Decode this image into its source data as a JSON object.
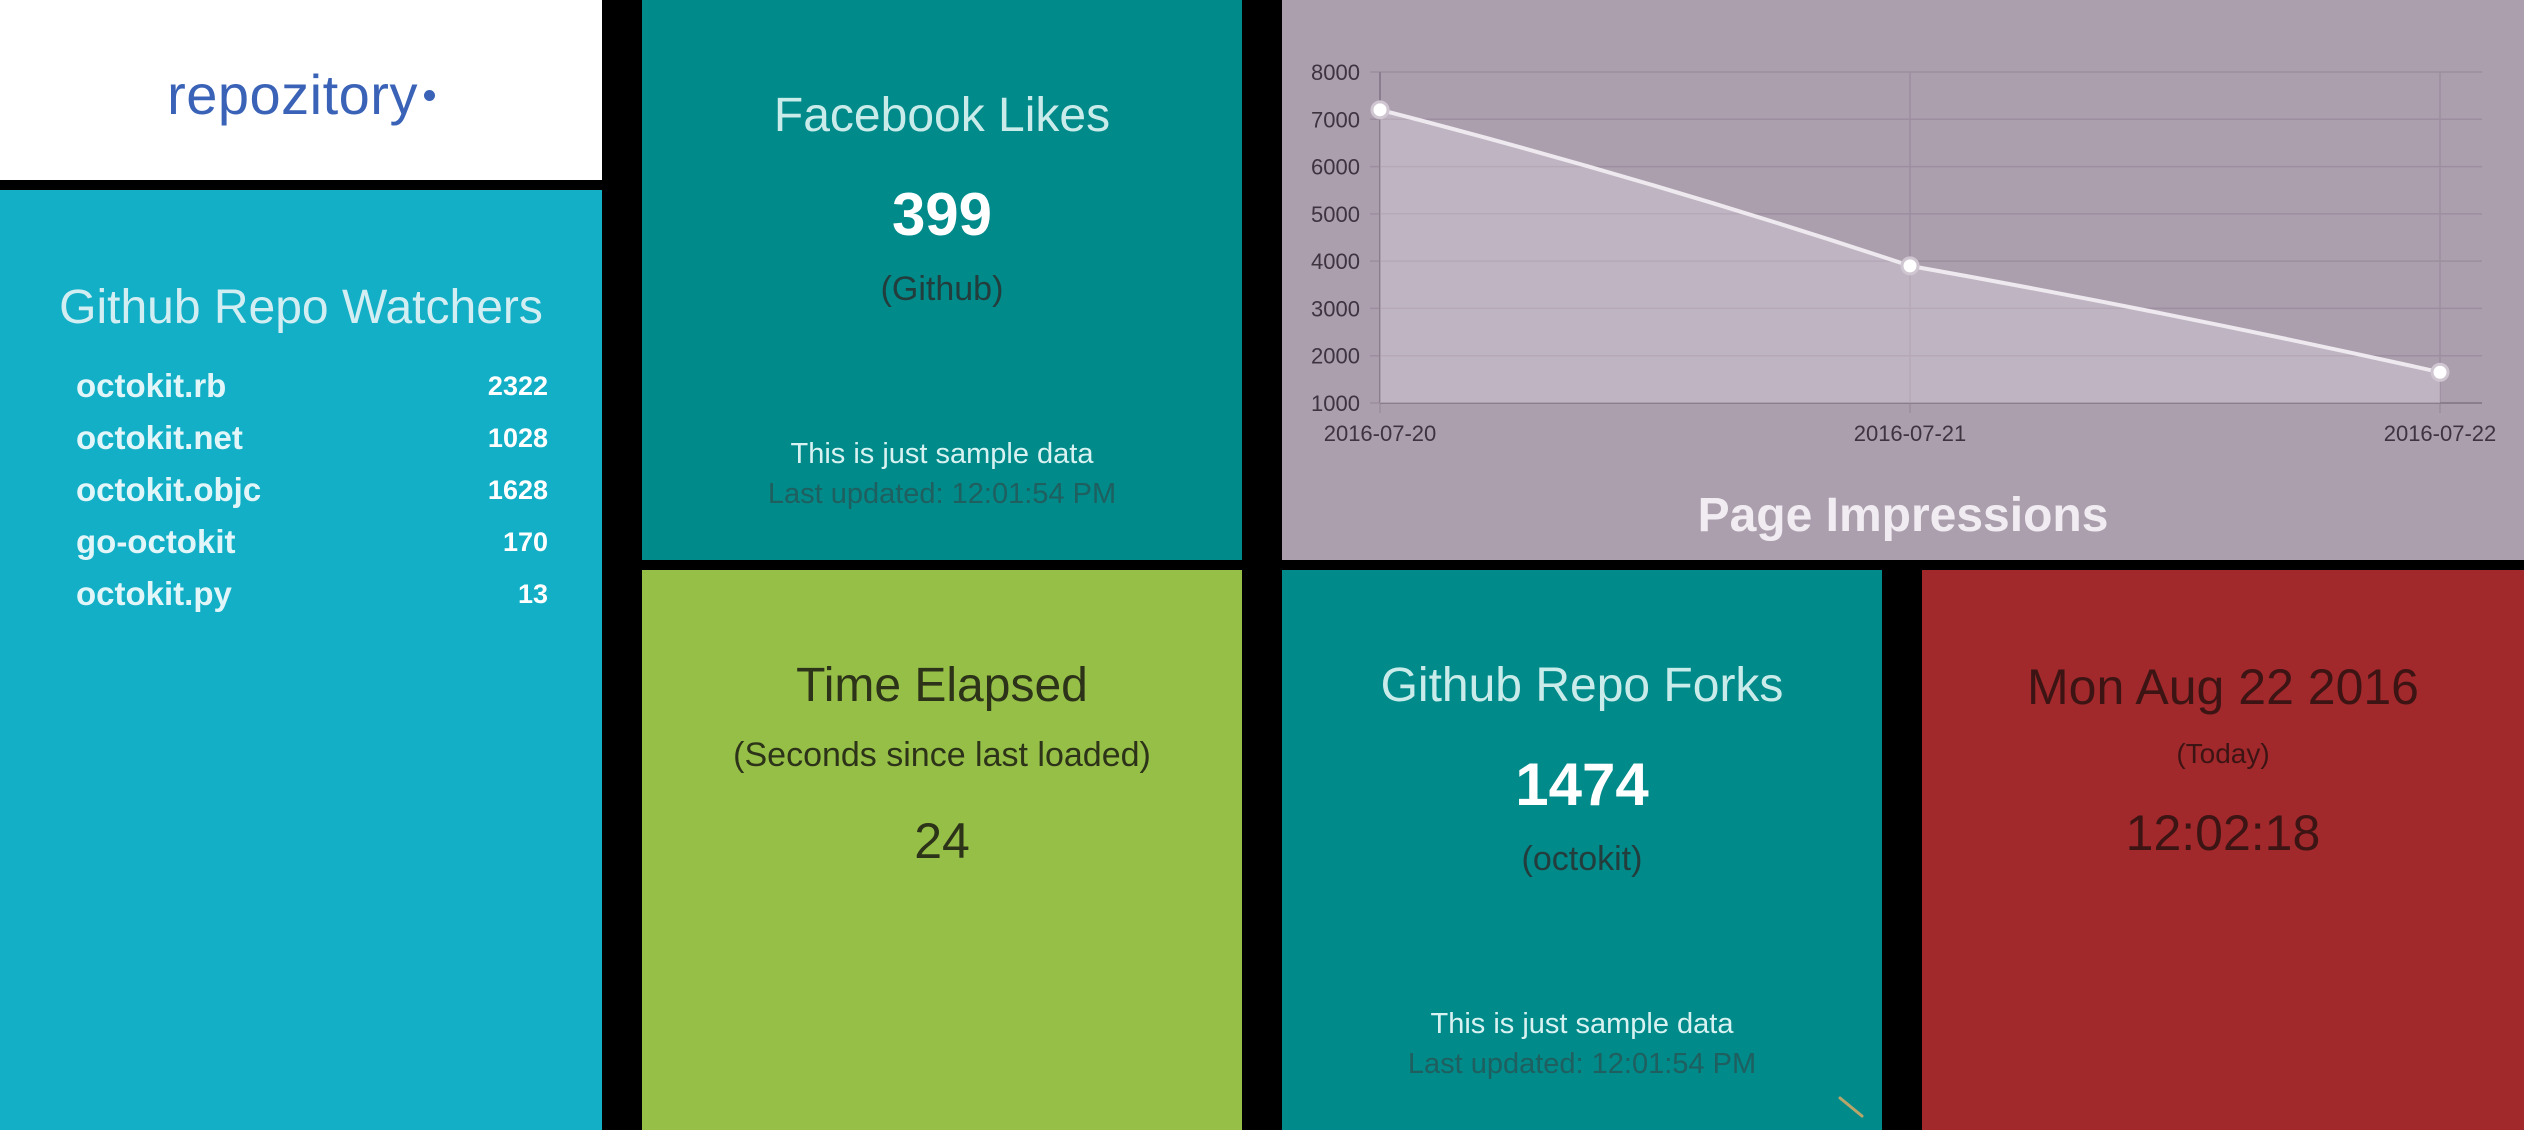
{
  "logo": {
    "text": "repozitory"
  },
  "watchers": {
    "title": "Github Repo Watchers",
    "items": [
      {
        "label": "octokit.rb",
        "value": "2322"
      },
      {
        "label": "octokit.net",
        "value": "1028"
      },
      {
        "label": "octokit.objc",
        "value": "1628"
      },
      {
        "label": "go-octokit",
        "value": "170"
      },
      {
        "label": "octokit.py",
        "value": "13"
      }
    ]
  },
  "facebook": {
    "title": "Facebook Likes",
    "value": "399",
    "subtitle": "(Github)",
    "more_info": "This is just sample data",
    "updated": "Last updated: 12:01:54 PM"
  },
  "impressions": {
    "title": "Page Impressions"
  },
  "chart_data": {
    "type": "line",
    "title": "Page Impressions",
    "x": [
      "2016-07-20",
      "2016-07-21",
      "2016-07-22"
    ],
    "series": [
      {
        "values": [
          7200,
          3900,
          1650
        ]
      }
    ],
    "ylim": [
      1000,
      8000
    ],
    "yticks": [
      1000,
      2000,
      3000,
      4000,
      5000,
      6000,
      7000,
      8000
    ],
    "grid": true,
    "fill": true
  },
  "elapsed": {
    "title": "Time Elapsed",
    "subtitle": "(Seconds since last loaded)",
    "value": "24"
  },
  "forks": {
    "title": "Github Repo Forks",
    "value": "1474",
    "subtitle": "(octokit)",
    "more_info": "This is just sample data",
    "updated": "Last updated: 12:01:54 PM"
  },
  "clock": {
    "date": "Mon Aug 22 2016",
    "label": "(Today)",
    "time": "12:02:18"
  },
  "colors": {
    "watchers": "#12afc6",
    "teal": "#008a8a",
    "chart": "#ab9fae",
    "green": "#96bf48",
    "red": "#a1282b"
  }
}
